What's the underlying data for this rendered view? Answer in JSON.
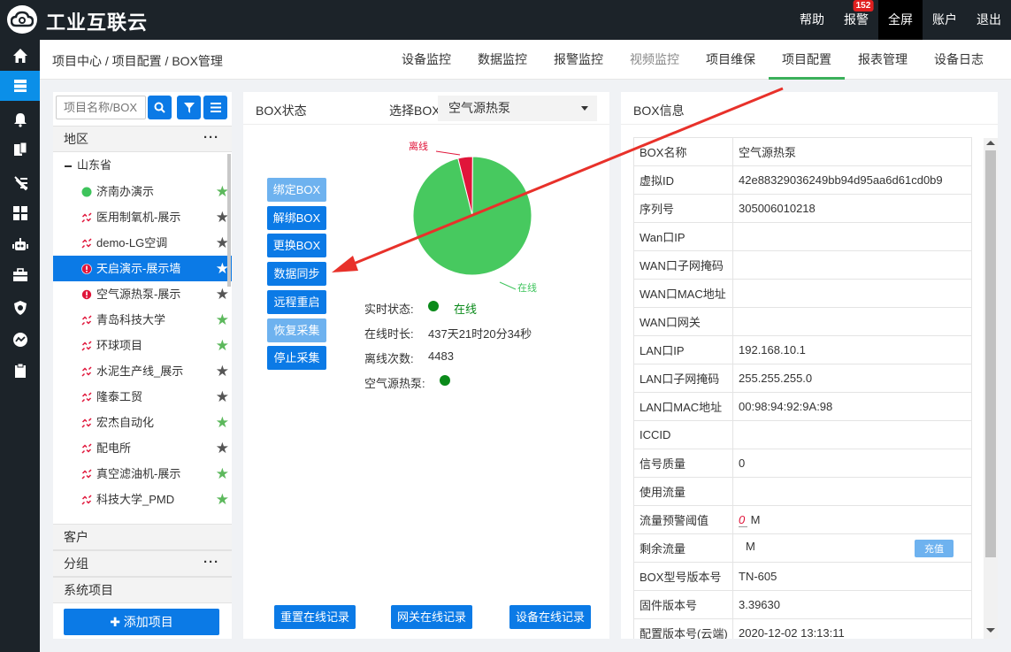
{
  "app": {
    "title": "工业互联云"
  },
  "topnav": {
    "help": "帮助",
    "alarm": "报警",
    "alarm_badge": "152",
    "fullscreen": "全屏",
    "account": "账户",
    "logout": "退出"
  },
  "sidebar_icons": [
    "home-icon",
    "server-icon",
    "bell-icon",
    "copy-icon",
    "tools-icon",
    "grid-icon",
    "robot-icon",
    "toolbox-icon",
    "shield-icon",
    "chart-icon",
    "clipboard-icon"
  ],
  "breadcrumb": "项目中心 / 项目配置 / BOX管理",
  "tabs": [
    {
      "label": "设备监控"
    },
    {
      "label": "数据监控"
    },
    {
      "label": "报警监控"
    },
    {
      "label": "视频监控"
    },
    {
      "label": "项目维保"
    },
    {
      "label": "项目配置"
    },
    {
      "label": "报表管理"
    },
    {
      "label": "设备日志"
    }
  ],
  "left": {
    "search_placeholder": "项目名称/BOX I",
    "region_label": "地区",
    "province": "山东省",
    "items": [
      {
        "label": "济南办演示",
        "status": "online",
        "star": "green"
      },
      {
        "label": "医用制氧机-展示",
        "status": "disconnected",
        "star": "gray"
      },
      {
        "label": "demo-LG空调",
        "status": "disconnected",
        "star": "gray"
      },
      {
        "label": "天启演示-展示墙",
        "status": "alarm",
        "star": "white"
      },
      {
        "label": "空气源热泵-展示",
        "status": "alarm",
        "star": "gray"
      },
      {
        "label": "青岛科技大学",
        "status": "disconnected",
        "star": "green"
      },
      {
        "label": "环球项目",
        "status": "disconnected",
        "star": "green"
      },
      {
        "label": "水泥生产线_展示",
        "status": "disconnected",
        "star": "gray"
      },
      {
        "label": "隆泰工贸",
        "status": "disconnected",
        "star": "gray"
      },
      {
        "label": "宏杰自动化",
        "status": "disconnected",
        "star": "green"
      },
      {
        "label": "配电所",
        "status": "disconnected",
        "star": "gray"
      },
      {
        "label": "真空滤油机-展示",
        "status": "disconnected",
        "star": "green"
      },
      {
        "label": "科技大学_PMD",
        "status": "disconnected",
        "star": "green"
      }
    ],
    "customer_label": "客户",
    "group_label": "分组",
    "system_label": "系统项目",
    "add_label": "✚ 添加项目"
  },
  "mid": {
    "title": "BOX状态",
    "select_label": "选择BOX",
    "select_value": "空气源热泵",
    "buttons": [
      "绑定BOX",
      "解绑BOX",
      "更换BOX",
      "数据同步",
      "远程重启",
      "恢复采集",
      "停止采集"
    ],
    "pie": {
      "online_label": "在线",
      "offline_label": "离线",
      "online_pct": 96,
      "offline_pct": 4
    },
    "stats": {
      "realtime_label": "实时状态:",
      "realtime_value": "在线",
      "duration_label": "在线时长:",
      "duration_value": "437天21时20分34秒",
      "offline_count_label": "离线次数:",
      "offline_count_value": "4483",
      "device_label": "空气源热泵:"
    },
    "bottom_buttons": [
      "重置在线记录",
      "网关在线记录",
      "设备在线记录"
    ]
  },
  "right": {
    "title": "BOX信息",
    "rows": [
      {
        "k": "BOX名称",
        "v": "空气源热泵"
      },
      {
        "k": "虚拟ID",
        "v": "42e88329036249bb94d95aa6d61cd0b9"
      },
      {
        "k": "序列号",
        "v": "305006010218"
      },
      {
        "k": "Wan口IP",
        "v": ""
      },
      {
        "k": "WAN口子网掩码",
        "v": ""
      },
      {
        "k": "WAN口MAC地址",
        "v": ""
      },
      {
        "k": "WAN口网关",
        "v": ""
      },
      {
        "k": "LAN口IP",
        "v": "192.168.10.1"
      },
      {
        "k": "LAN口子网掩码",
        "v": "255.255.255.0"
      },
      {
        "k": "LAN口MAC地址",
        "v": "00:98:94:92:9A:98"
      },
      {
        "k": "ICCID",
        "v": ""
      },
      {
        "k": "信号质量",
        "v": "0"
      },
      {
        "k": "使用流量",
        "v": ""
      },
      {
        "k": "流量预警阈值",
        "v": "0",
        "unit": "M"
      },
      {
        "k": "剩余流量",
        "v": "M",
        "button": "充值"
      },
      {
        "k": "BOX型号版本号",
        "v": "TN-605"
      },
      {
        "k": "固件版本号",
        "v": "3.39630"
      },
      {
        "k": "配置版本号(云端)",
        "v": "2020-12-02 13:13:11"
      }
    ]
  }
}
